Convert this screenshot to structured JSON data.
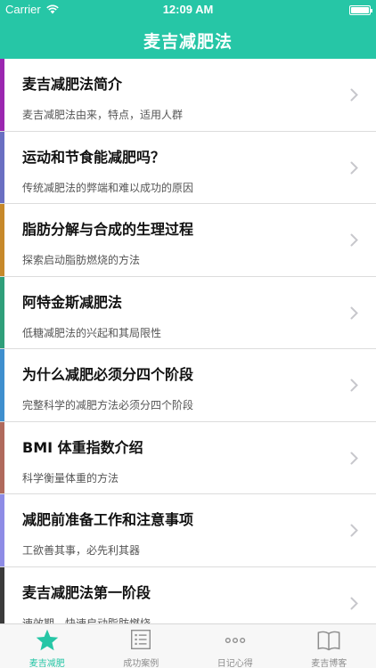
{
  "status_bar": {
    "carrier": "Carrier",
    "time": "12:09 AM"
  },
  "nav": {
    "title": "麦吉减肥法"
  },
  "colors": {
    "brand": "#26c6a6",
    "tab_inactive": "#8e8e8e"
  },
  "articles": [
    {
      "title": "麦吉减肥法简介",
      "subtitle": "麦吉减肥法由来，特点，适用人群",
      "accent": "#9b27b0"
    },
    {
      "title": "运动和节食能减肥吗？",
      "subtitle": "传统减肥法的弊端和难以成功的原因",
      "accent": "#6a6fc2"
    },
    {
      "title": "脂肪分解与合成的生理过程",
      "subtitle": "探索启动脂肪燃烧的方法",
      "accent": "#c7892a"
    },
    {
      "title": "阿特金斯减肥法",
      "subtitle": "低糖减肥法的兴起和其局限性",
      "accent": "#2f9f7a"
    },
    {
      "title": "为什么减肥必须分四个阶段",
      "subtitle": "完整科学的减肥方法必须分四个阶段",
      "accent": "#3f8fce"
    },
    {
      "title": "BMI 体重指数介绍",
      "subtitle": "科学衡量体重的方法",
      "accent": "#b06a5c"
    },
    {
      "title": "减肥前准备工作和注意事项",
      "subtitle": "工欲善其事，必先利其器",
      "accent": "#8e8ce6"
    },
    {
      "title": "麦吉减肥法第一阶段",
      "subtitle": "速效期，快速启动脂肪燃烧",
      "accent": "#3b3b3b"
    }
  ],
  "tabs": [
    {
      "label": "麦吉减肥",
      "icon": "star-icon",
      "active": true
    },
    {
      "label": "成功案例",
      "icon": "list-icon",
      "active": false
    },
    {
      "label": "日记心得",
      "icon": "more-dots-icon",
      "active": false
    },
    {
      "label": "麦吉博客",
      "icon": "book-icon",
      "active": false
    }
  ]
}
